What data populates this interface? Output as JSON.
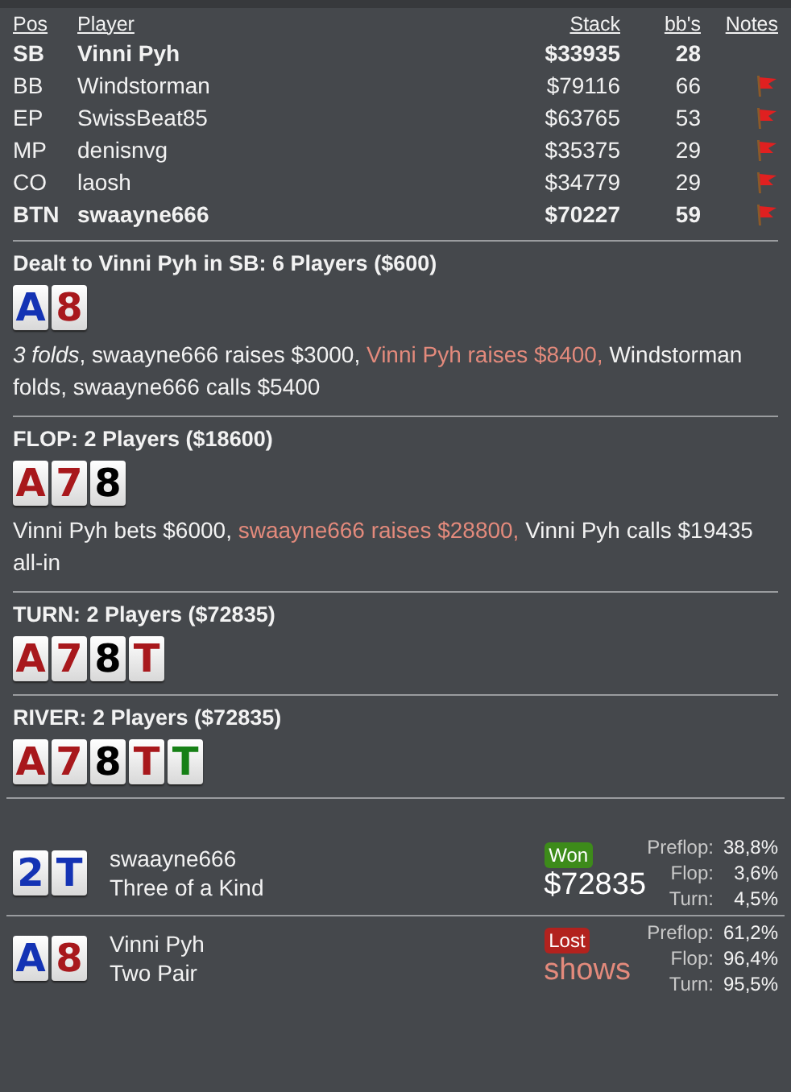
{
  "players": {
    "columns": [
      "Pos",
      "Player",
      "Stack",
      "bb's",
      "Notes"
    ],
    "rows": [
      {
        "pos": "SB",
        "name": "Vinni Pyh",
        "stack": "$33935",
        "bbs": "28",
        "hero": true,
        "note": false
      },
      {
        "pos": "BB",
        "name": "Windstorman",
        "stack": "$79116",
        "bbs": "66",
        "hero": false,
        "note": true
      },
      {
        "pos": "EP",
        "name": "SwissBeat85",
        "stack": "$63765",
        "bbs": "53",
        "hero": false,
        "note": true
      },
      {
        "pos": "MP",
        "name": "denisnvg",
        "stack": "$35375",
        "bbs": "29",
        "hero": false,
        "note": true
      },
      {
        "pos": "CO",
        "name": "laosh",
        "stack": "$34779",
        "bbs": "29",
        "hero": false,
        "note": true
      },
      {
        "pos": "BTN",
        "name": "swaayne666",
        "stack": "$70227",
        "bbs": "59",
        "hero": true,
        "note": true
      }
    ]
  },
  "streets": [
    {
      "title": "Dealt to Vinni Pyh in SB: 6 Players ($600)",
      "cards": [
        {
          "rank": "A",
          "color": "#1433b4"
        },
        {
          "rank": "8",
          "color": "#a8181c"
        }
      ],
      "actions": [
        {
          "text": "*3 folds*, swaayne666 raises $3000, ",
          "highlight": false
        },
        {
          "text": "Vinni Pyh raises $8400, ",
          "highlight": true
        },
        {
          "text": "Windstorman folds, swaayne666 calls $5400",
          "highlight": false
        }
      ]
    },
    {
      "title": "FLOP: 2 Players ($18600)",
      "cards": [
        {
          "rank": "A",
          "color": "#a8181c"
        },
        {
          "rank": "7",
          "color": "#a8181c"
        },
        {
          "rank": "8",
          "color": "#000000"
        }
      ],
      "actions": [
        {
          "text": "Vinni Pyh bets $6000, ",
          "highlight": false
        },
        {
          "text": "swaayne666 raises $28800, ",
          "highlight": true
        },
        {
          "text": "Vinni Pyh calls $19435 all-in",
          "highlight": false
        }
      ]
    },
    {
      "title": "TURN: 2 Players ($72835)",
      "cards": [
        {
          "rank": "A",
          "color": "#a8181c"
        },
        {
          "rank": "7",
          "color": "#a8181c"
        },
        {
          "rank": "8",
          "color": "#000000"
        },
        {
          "rank": "T",
          "color": "#a8181c"
        }
      ]
    },
    {
      "title": "RIVER: 2 Players ($72835)",
      "cards": [
        {
          "rank": "A",
          "color": "#a8181c"
        },
        {
          "rank": "7",
          "color": "#a8181c"
        },
        {
          "rank": "8",
          "color": "#000000"
        },
        {
          "rank": "T",
          "color": "#a8181c"
        },
        {
          "rank": "T",
          "color": "#168016"
        }
      ]
    }
  ],
  "results": [
    {
      "cards": [
        {
          "rank": "2",
          "color": "#1433b4"
        },
        {
          "rank": "T",
          "color": "#1433b4"
        }
      ],
      "name": "swaayne666",
      "hand": "Three of a Kind",
      "kind": "won",
      "badge": "Won",
      "amount": "$72835",
      "equity": [
        {
          "label": "Preflop:",
          "value": "38,8%"
        },
        {
          "label": "Flop:",
          "value": "3,6%"
        },
        {
          "label": "Turn:",
          "value": "4,5%"
        }
      ]
    },
    {
      "cards": [
        {
          "rank": "A",
          "color": "#1433b4"
        },
        {
          "rank": "8",
          "color": "#a8181c"
        }
      ],
      "name": "Vinni Pyh",
      "hand": "Two Pair",
      "kind": "lost",
      "badge": "Lost",
      "amount": "shows",
      "equity": [
        {
          "label": "Preflop:",
          "value": "61,2%"
        },
        {
          "label": "Flop:",
          "value": "96,4%"
        },
        {
          "label": "Turn:",
          "value": "95,5%"
        }
      ]
    }
  ]
}
